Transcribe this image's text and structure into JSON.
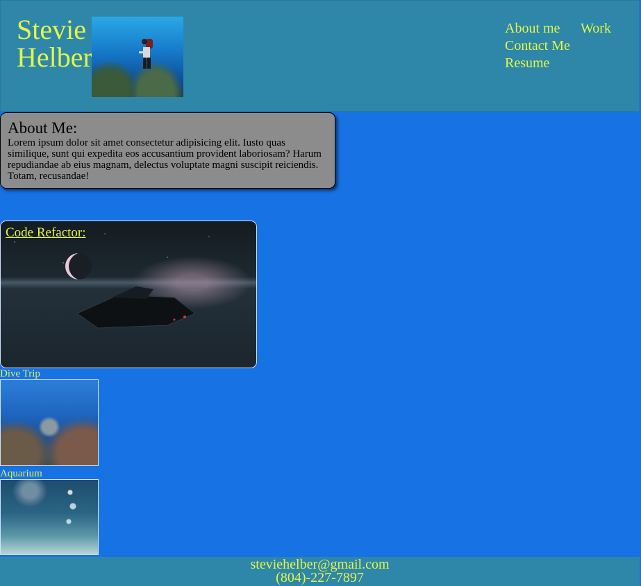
{
  "header": {
    "name_line1": "Stevie",
    "name_line2": "Helber",
    "photo_alt": "scuba diver photo"
  },
  "nav": {
    "items": [
      "About me",
      "Work",
      "Contact Me",
      "Resume"
    ]
  },
  "about": {
    "heading": "About Me:",
    "body": "Lorem ipsum dolor sit amet consectetur adipisicing elit. Iusto quas similique, sunt qui expedita eos accusantium provident laboriosam? Harum repudiandae ab eius magnam, delectus voluptate magni suscipit reiciendis. Totam, recusandae!"
  },
  "work": {
    "featured_title": "Code Refactor:",
    "gallery": [
      "Dive Trip",
      "Aquarium"
    ]
  },
  "footer": {
    "email": "steviehelber@gmail.com",
    "phone": "(804)-227-7897"
  },
  "colors": {
    "background": "#1772e4",
    "header_bg": "#2e87a8",
    "accent_text": "#e3f54a",
    "about_card_bg": "#8c8c8c"
  },
  "icons": [
    "diver-photo",
    "spaceship-screenshot",
    "reef-photo",
    "aquarium-photo"
  ]
}
